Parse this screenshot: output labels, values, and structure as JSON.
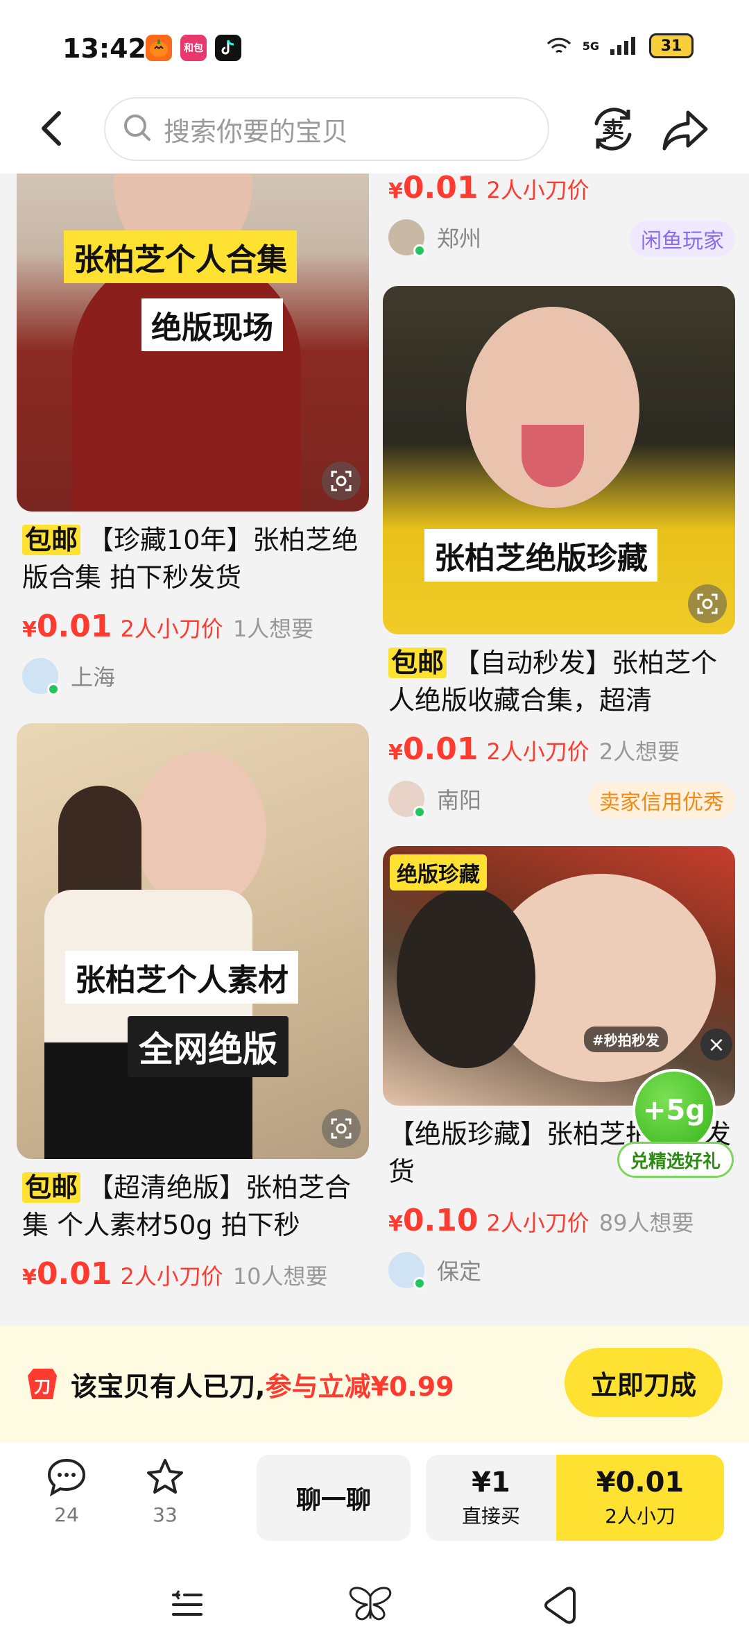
{
  "status_bar": {
    "time": "13:42",
    "apps": [
      "和包"
    ],
    "network": "5G",
    "battery": "31"
  },
  "header": {
    "search_placeholder": "搜索你要的宝贝",
    "sell_icon_label": "卖"
  },
  "feed": {
    "left": [
      {
        "captions": [
          "张柏芝个人合集",
          "绝版现场"
        ],
        "badge": "包邮",
        "title": "【珍藏10年】张柏芝绝版合集 拍下秒发货",
        "currency": "¥",
        "price": "0.01",
        "cut_label": "2人小刀价",
        "want": "1人想要",
        "city": "上海"
      },
      {
        "captions": [
          "张柏芝个人素材",
          "全网绝版"
        ],
        "badge": "包邮",
        "title": "【超清绝版】张柏芝合集 个人素材50g 拍下秒",
        "currency": "¥",
        "price": "0.01",
        "cut_label": "2人小刀价",
        "want": "10人想要"
      }
    ],
    "right": [
      {
        "currency": "¥",
        "price": "0.01",
        "cut_label": "2人小刀价",
        "city": "郑州",
        "seller_badge": "闲鱼玩家"
      },
      {
        "captions": [
          "张柏芝绝版珍藏"
        ],
        "badge": "包邮",
        "title": "【自动秒发】张柏芝个人绝版收藏合集，超清",
        "currency": "¥",
        "price": "0.01",
        "cut_label": "2人小刀价",
        "want": "2人想要",
        "city": "南阳",
        "seller_badge": "卖家信用优秀"
      },
      {
        "corner_tag": "绝版珍藏",
        "inline_tag": "#秒拍秒发",
        "title": "【绝版珍藏】张柏芝拍下秒发货",
        "currency": "¥",
        "price": "0.10",
        "cut_label": "2人小刀价",
        "want": "89人想要",
        "city": "保定"
      }
    ]
  },
  "float": {
    "close": "×",
    "ball": "+5g",
    "pill": "兑精选好礼"
  },
  "promo": {
    "icon_label": "刀",
    "text": "该宝贝有人已刀,",
    "highlight": "参与立减¥0.99",
    "button": "立即刀成"
  },
  "action_bar": {
    "comments": "24",
    "favorites": "33",
    "chat": "聊一聊",
    "direct_price": "¥1",
    "direct_label": "直接买",
    "cut_price": "¥0.01",
    "cut_label": "2人小刀"
  },
  "colors": {
    "accent_yellow": "#ffe231",
    "price_red": "#ff3b30",
    "online_green": "#22c55e"
  }
}
